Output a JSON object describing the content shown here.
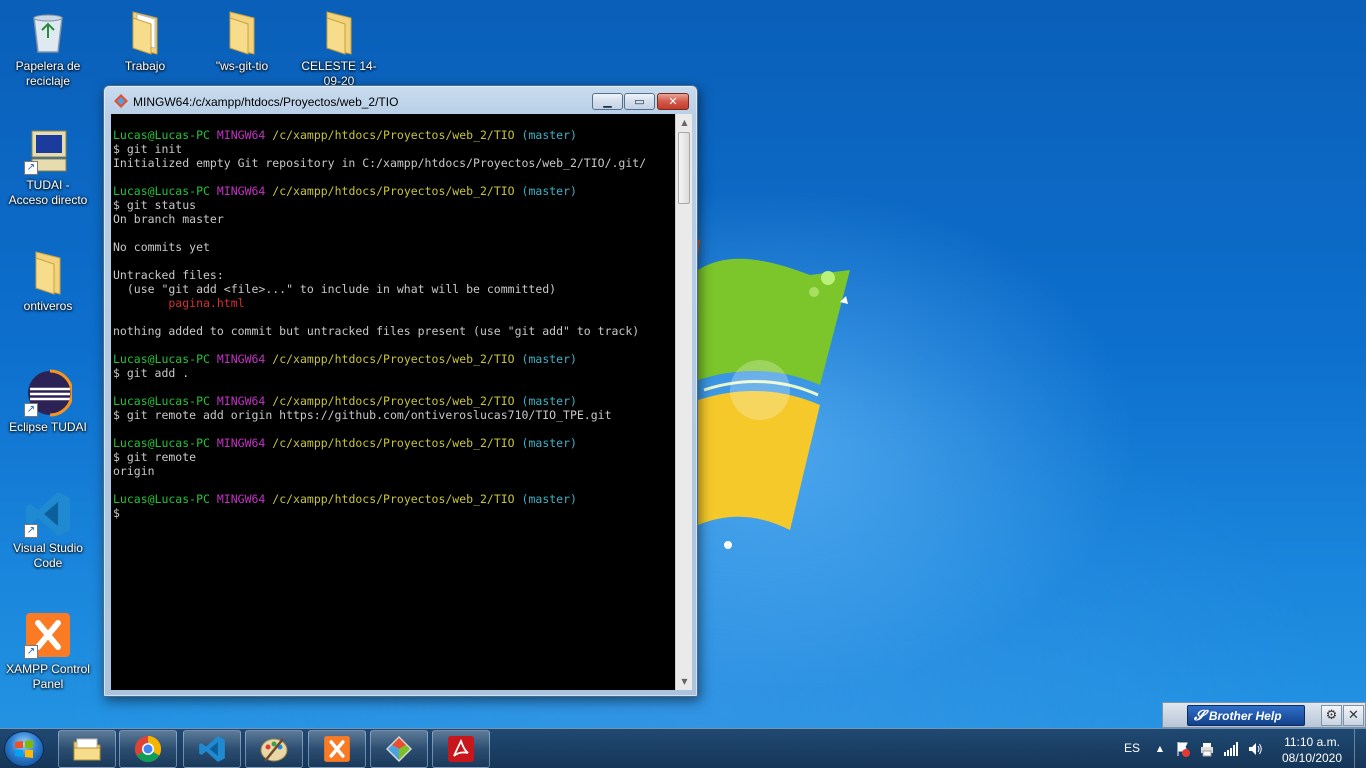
{
  "desktop": {
    "icons": [
      {
        "label": "Papelera de reciclaje",
        "icon": "recycle-bin-icon"
      },
      {
        "label": "Trabajo",
        "icon": "folder-icon"
      },
      {
        "label": "\"ws-git-tio",
        "icon": "folder-icon"
      },
      {
        "label": "CELESTE 14-09-20",
        "icon": "folder-icon"
      },
      {
        "label": "TUDAI - Acceso directo",
        "icon": "computer-icon"
      },
      {
        "label": "ontiveros",
        "icon": "folder-icon"
      },
      {
        "label": "Eclipse TUDAI",
        "icon": "eclipse-icon"
      },
      {
        "label": "Visual Studio Code",
        "icon": "vscode-icon"
      },
      {
        "label": "XAMPP Control Panel",
        "icon": "xampp-icon"
      }
    ]
  },
  "terminal": {
    "title": "MINGW64:/c/xampp/htdocs/Proyectos/web_2/TIO",
    "prompt": {
      "user": "Lucas@Lucas-PC",
      "host": "MINGW64",
      "path": "/c/xampp/htdocs/Proyectos/web_2/TIO",
      "branch": "(master)"
    },
    "lines": {
      "cmd1": "$ git init",
      "out1": "Initialized empty Git repository in C:/xampp/htdocs/Proyectos/web_2/TIO/.git/",
      "cmd2": "$ git status",
      "out2a": "On branch master",
      "out2b": "No commits yet",
      "out2c": "Untracked files:",
      "out2d": "  (use \"git add <file>...\" to include in what will be committed)",
      "out2e": "        pagina.html",
      "out2f": "nothing added to commit but untracked files present (use \"git add\" to track)",
      "cmd3": "$ git add .",
      "cmd4": "$ git remote add origin https://github.com/ontiveroslucas710/TIO_TPE.git",
      "cmd5": "$ git remote",
      "out5": "origin",
      "cursor": "$"
    }
  },
  "brother": {
    "label": "Brother Help"
  },
  "taskbar": {
    "apps": [
      "file-explorer",
      "chrome",
      "vscode",
      "paint",
      "xampp",
      "git-gui",
      "acrobat"
    ],
    "language": "ES",
    "time": "11:10 a.m.",
    "date": "08/10/2020"
  },
  "colors": {
    "prompt_user": "#23c435",
    "prompt_host": "#c332c3",
    "prompt_path": "#c7c43a",
    "prompt_branch": "#3ab3c7",
    "untracked_file": "#d43030"
  }
}
